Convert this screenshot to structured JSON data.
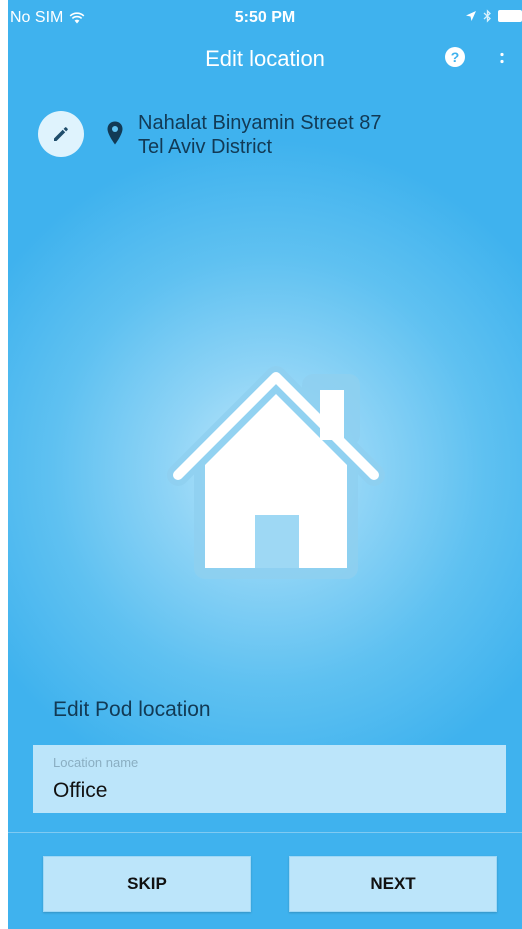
{
  "status_bar": {
    "carrier": "No SIM",
    "time": "5:50 PM"
  },
  "header": {
    "title": "Edit location",
    "help_icon": "question-circle-icon",
    "more_icon": "more-vertical-icon"
  },
  "address": {
    "edit_icon": "pencil-icon",
    "pin_icon": "location-pin-icon",
    "line1": "Nahalat Binyamin Street 87",
    "line2": "Tel Aviv District"
  },
  "illustration": {
    "icon": "house-icon"
  },
  "form": {
    "section_title": "Edit Pod location",
    "location_name": {
      "label": "Location name",
      "value": "Office"
    }
  },
  "actions": {
    "skip_label": "SKIP",
    "next_label": "NEXT"
  },
  "colors": {
    "background": "#3fb2ee",
    "background_center": "#bfe8fb",
    "field_bg": "#bce5fa",
    "text_dark": "#123a55"
  }
}
